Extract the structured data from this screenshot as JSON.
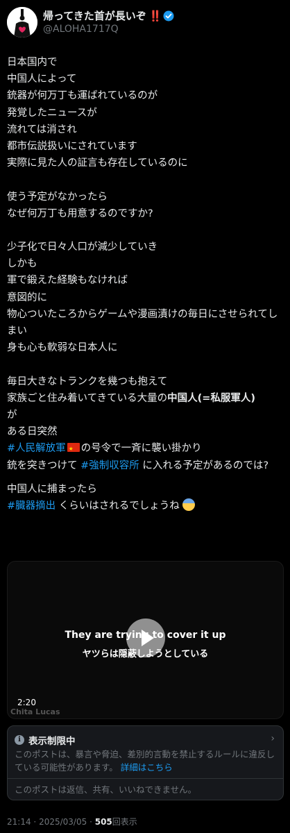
{
  "author": {
    "display_name": "帰ってきた首が長いぞ",
    "display_name_suffix": "‼️",
    "handle": "@ALOHA1717Q",
    "verified": true,
    "verified_color": "#1d9bf0"
  },
  "post": {
    "lines": [
      "日本国内で",
      "中国人によって",
      "銃器が何万丁も運ばれているのが",
      "発覚したニュースが",
      "流れては消され",
      "都市伝説扱いにされています",
      "実際に見た人の証言も存在しているのに",
      "使う予定がなかったら",
      "なぜ何万丁も用意するのですか?",
      "少子化で日々人口が減少していき",
      "しかも",
      "軍で鍛えた経験もなければ",
      "意図的に",
      "物心ついたころからゲームや漫画漬けの毎日にさせられてしまい",
      "身も心も軟弱な日本人に",
      "毎日大きなトランクを幾つも抱えて",
      "家族ごと住み着いてきている大量の",
      "中国人(=私服軍人)",
      "が",
      "ある日突然",
      "#人民解放軍",
      "の号令で一斉に襲い掛かり",
      "銃を突きつけて ",
      "#強制収容所",
      " に入れる予定があるのでは?",
      "中国人に捕まったら",
      "#臓器摘出",
      " くらいはされるでしょうね"
    ]
  },
  "video": {
    "subtitle_en": "They are trying to cover it up",
    "subtitle_ja": "ヤツらは隠蔽しようとしている",
    "duration": "2:20",
    "watermark": "Chita Lucas"
  },
  "restriction": {
    "title": "表示制限中",
    "description": "このポストは、暴言や脅迫、差別的言動を禁止するルールに違反している可能性があります。",
    "link_label": "詳細はこちら",
    "note": "このポストは返信、共有、いいねできません。"
  },
  "meta": {
    "time": "21:14",
    "separator": "·",
    "date": "2025/03/05",
    "views_count": "505",
    "views_label": "回表示"
  },
  "colors": {
    "background": "#000000",
    "text": "#e7e9ea",
    "muted": "#71767b",
    "link": "#1d9bf0",
    "card": "#16181c"
  }
}
